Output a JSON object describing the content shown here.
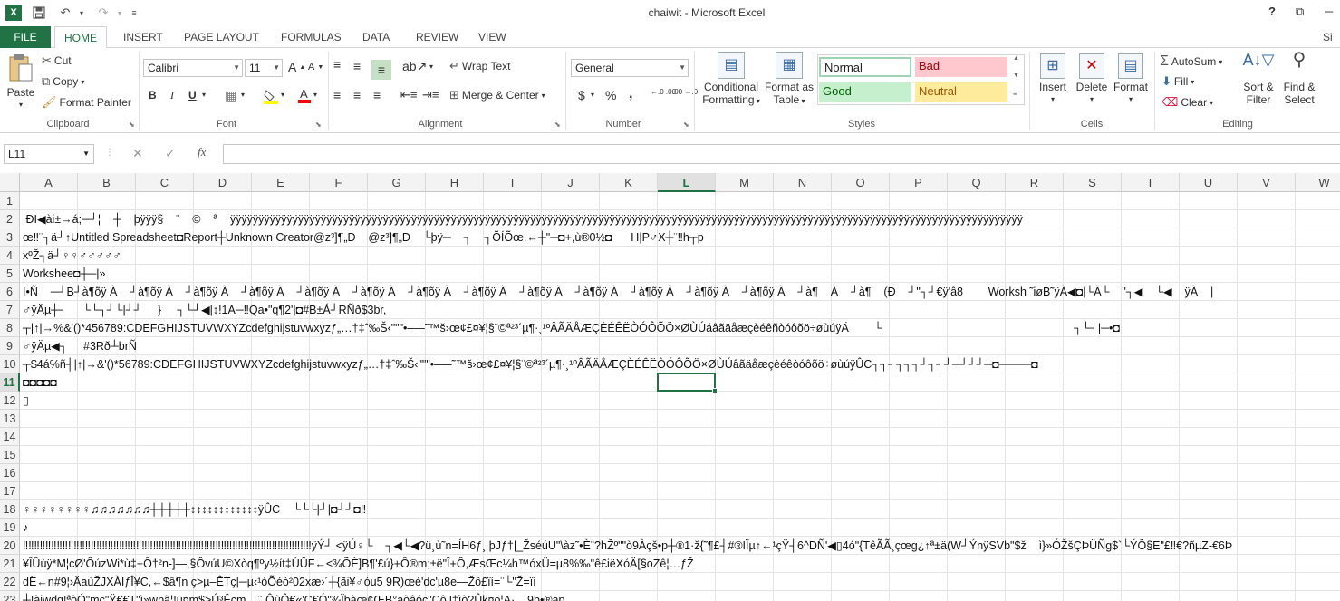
{
  "window": {
    "title": "chaiwit - Microsoft Excel",
    "help": "?",
    "restore": "⧉",
    "minimize": "─"
  },
  "tabs": [
    {
      "label": "FILE"
    },
    {
      "label": "HOME"
    },
    {
      "label": "INSERT"
    },
    {
      "label": "PAGE LAYOUT"
    },
    {
      "label": "FORMULAS"
    },
    {
      "label": "DATA"
    },
    {
      "label": "REVIEW"
    },
    {
      "label": "VIEW"
    }
  ],
  "account": "Si",
  "clipboard": {
    "paste": "Paste",
    "cut": "Cut",
    "copy": "Copy",
    "format_painter": "Format Painter",
    "group": "Clipboard"
  },
  "font": {
    "name": "Calibri",
    "size": "11",
    "bold": "B",
    "italic": "I",
    "underline": "U",
    "grow": "A",
    "shrink": "A",
    "group": "Font"
  },
  "alignment": {
    "wrap_text": "Wrap Text",
    "merge_center": "Merge & Center",
    "group": "Alignment"
  },
  "number": {
    "format": "General",
    "currency": "$",
    "percent": "%",
    "comma": ",",
    "inc_decimal": "←.0 .00",
    "dec_decimal": ".00 →.0",
    "group": "Number"
  },
  "styles": {
    "conditional": "Conditional Formatting",
    "format_as_table": "Format as Table",
    "normal": "Normal",
    "bad": "Bad",
    "good": "Good",
    "neutral": "Neutral",
    "group": "Styles"
  },
  "cells": {
    "insert": "Insert",
    "delete": "Delete",
    "format": "Format",
    "group": "Cells"
  },
  "editing": {
    "autosum": "AutoSum",
    "fill": "Fill",
    "clear": "Clear",
    "sort_filter": "Sort & Filter",
    "find_select": "Find & Select",
    "group": "Editing"
  },
  "formula_bar": {
    "name_box": "L11",
    "fx": "fx",
    "cancel": "✕",
    "enter": "✓",
    "content": ""
  },
  "columns": [
    "A",
    "B",
    "C",
    "D",
    "E",
    "F",
    "G",
    "H",
    "I",
    "J",
    "K",
    "L",
    "M",
    "N",
    "O",
    "P",
    "Q",
    "R",
    "S",
    "T",
    "U",
    "V",
    "W"
  ],
  "selected_column": "L",
  "selected_row": "11",
  "rows": [
    {
      "n": "1",
      "text": ""
    },
    {
      "n": "2",
      "text": " ÐI◀ài±→á;─┘¦    ┼    þÿÿÿ§    ¨    ©    ª    ÿÿÿÿÿÿÿÿÿÿÿÿÿÿÿÿÿÿÿÿÿÿÿÿÿÿÿÿÿÿÿÿÿÿÿÿÿÿÿÿÿÿÿÿÿÿÿÿÿÿÿÿÿÿÿÿÿÿÿÿÿÿÿÿÿÿÿÿÿÿÿÿÿÿÿÿÿÿÿÿÿÿÿÿÿÿÿÿÿÿÿÿÿÿÿÿÿÿÿÿÿÿÿÿÿÿÿÿÿÿÿÿÿÿÿÿÿÿÿÿÿÿÿÿÿÿÿÿÿÿÿÿÿÿÿÿÿÿÿÿ"
    },
    {
      "n": "3",
      "text": "œ‼¨┐ä┘↑Untitled Spreadsheet◘Report┼Unknown Creator@z³]¶„Ð    @z³]¶„Ð    └þÿ─    ┐    ┐ÕÍÕœ.←┼\"─◘+,ù®0½◘      H|P♂X┼¨‼h┬p"
    },
    {
      "n": "4",
      "text": "xºŽ┐ä┘♀♀♂♂♂♂♂"
    },
    {
      "n": "5",
      "text": "Workshee◘┼─|»"
    },
    {
      "n": "6",
      "text": "I•Ñ    ─┘B┘à¶õÿ À    ┘à¶õÿ À    ┘à¶õÿ À    ┘à¶õÿ À    ┘à¶õÿ À    ┘à¶õÿ À    ┘à¶õÿ À    ┘à¶õÿ À    ┘à¶õÿ À    ┘à¶õÿ À    ┘à¶õÿ À    ┘à¶õÿ À    ┘à¶õÿ À    ┘à¶    À    ┘à¶    (Ð    ┘\"┐┘€ÿ'â8        Worksh ˜iøB˜ÿÀ◀◘|└À└    \"┐◀    └◀    ÿÀ    |"
    },
    {
      "n": "7",
      "text": "♂ÿÄµ┼┐     └└┐┘└|┘┘     }     ┐└┘◀|↕!1A─‼Qa•\"q¶2'|◘#B±Á┘RÑð$3br,"
    },
    {
      "n": "8",
      "text": "┬|↑|→%&'()*456789:CDEFGHIJSTUVWXYZcdefghijstuvwxyzƒ„…†‡ˆ‰Š‹\"\"\"•–—˜™š›œ¢£¤¥¦§¨©ª²³´µ¶·¸¹ºÂÃÄÅÆÇÈÉÊËÒÓÔÕÖ×ØÙÚáâãäåæçèéêñòóôõö÷øùúÿÄ        └                                                             ┐└┘|─•◘"
    },
    {
      "n": "9",
      "text": "♂ÿÄµ◀┐     #3Rð┴brÑ"
    },
    {
      "n": "10",
      "text": "┬$4á%ñ┤|↑|→&'()*56789:CDEFGHIJSTUVWXYZcdefghijstuvwxyzƒ„…†‡ˆ‰Š‹\"\"\"•–—˜™š›œ¢£¤¥¦§¨©ª²³´µ¶·¸¹ºÂÃÄÅÆÇÈÉÊËÒÓÔÕÖ×ØÙÚâãäåæçèéêòóôõö÷øùúÿÛC┐┐┐┐┐┐┘┐┐┘─┘┘┘─◘────◘"
    },
    {
      "n": "11",
      "text": "◘◘◘◘◘"
    },
    {
      "n": "12",
      "text": "▯"
    },
    {
      "n": "13",
      "text": ""
    },
    {
      "n": "14",
      "text": ""
    },
    {
      "n": "15",
      "text": ""
    },
    {
      "n": "16",
      "text": ""
    },
    {
      "n": "17",
      "text": ""
    },
    {
      "n": "18",
      "text": "♀♀♀♀♀♀♀♀♫♫♫♫♫♫♫┼┼┼┼┼↕↕↕↕↕↕↕↕↕↕↕↕ÿÛC    └└└|┘|◘┘┘◘‼"
    },
    {
      "n": "19",
      "text": "♪"
    },
    {
      "n": "20",
      "text": "‼‼‼‼‼‼‼‼‼‼‼‼‼‼‼‼‼‼‼‼‼‼‼‼‼‼‼‼‼‼‼‼‼‼‼‼‼‼‼‼‼‼‼‼‼‼‼‼‼‼‼ÿÝ┘ <ÿÚ♀└    ┐◀└◀?ü¸ù˜n=ÍH6ƒ¸ þJƒ†|_ŽséúU\"\\àz˜•È¨?hŽº\"\"ò9Àçš•p┼®1·ž{˜¶£┤#®IÏµ↑←¹çŸ┤6^DÑ'◀▯4ó\"{TêÃÃ¸çœg¿↑ª±ä(W┘ÝnÿSVb\"$ž    ì}»ÓŽšÇÞÜÑg$`└ÝÖ§E\"£‼€?ñµZ-€6Þ"
    },
    {
      "n": "21",
      "text": "¥ÎÛùÿ*M¦cØ'ÔúzWi*ù‡+Ô†²n-]—,§ÔvúU©Xòq¶ºy½ít‡ÚÛF←<¾ÕÈ]B¶'£ú}+Ô®m;±ë\"Î+Ô,ÆsŒc¼h™óxÜ=µ8%‰\"ê£iëXóÄ[§oZê¦…ƒŽ"
    },
    {
      "n": "22",
      "text": "dË←n#9¦›ÄaùŽJXÀIƒÎ¥C,←$â¶n ç>µ–ÊTç|─µ‹¹óÕéò²02xæ›´┼{ãi¥♂óu5 9R)œé'dc'µ8e—Žô£ïí=¨└\"Ž=ïì"
    },
    {
      "n": "23",
      "text": "┼!àiwdq!ªòÓ\"mc\"Ÿ€€T\"ì»wbã¦!ü¤m$>Ú³Êcm    ˜ ÔùÔ€«'Ç€Ó\"¾Ïbàœ¢ŒB°aòâóç\"ÇôJ‡ìò?Ûk¤o¦A·    9b•®ap"
    }
  ]
}
